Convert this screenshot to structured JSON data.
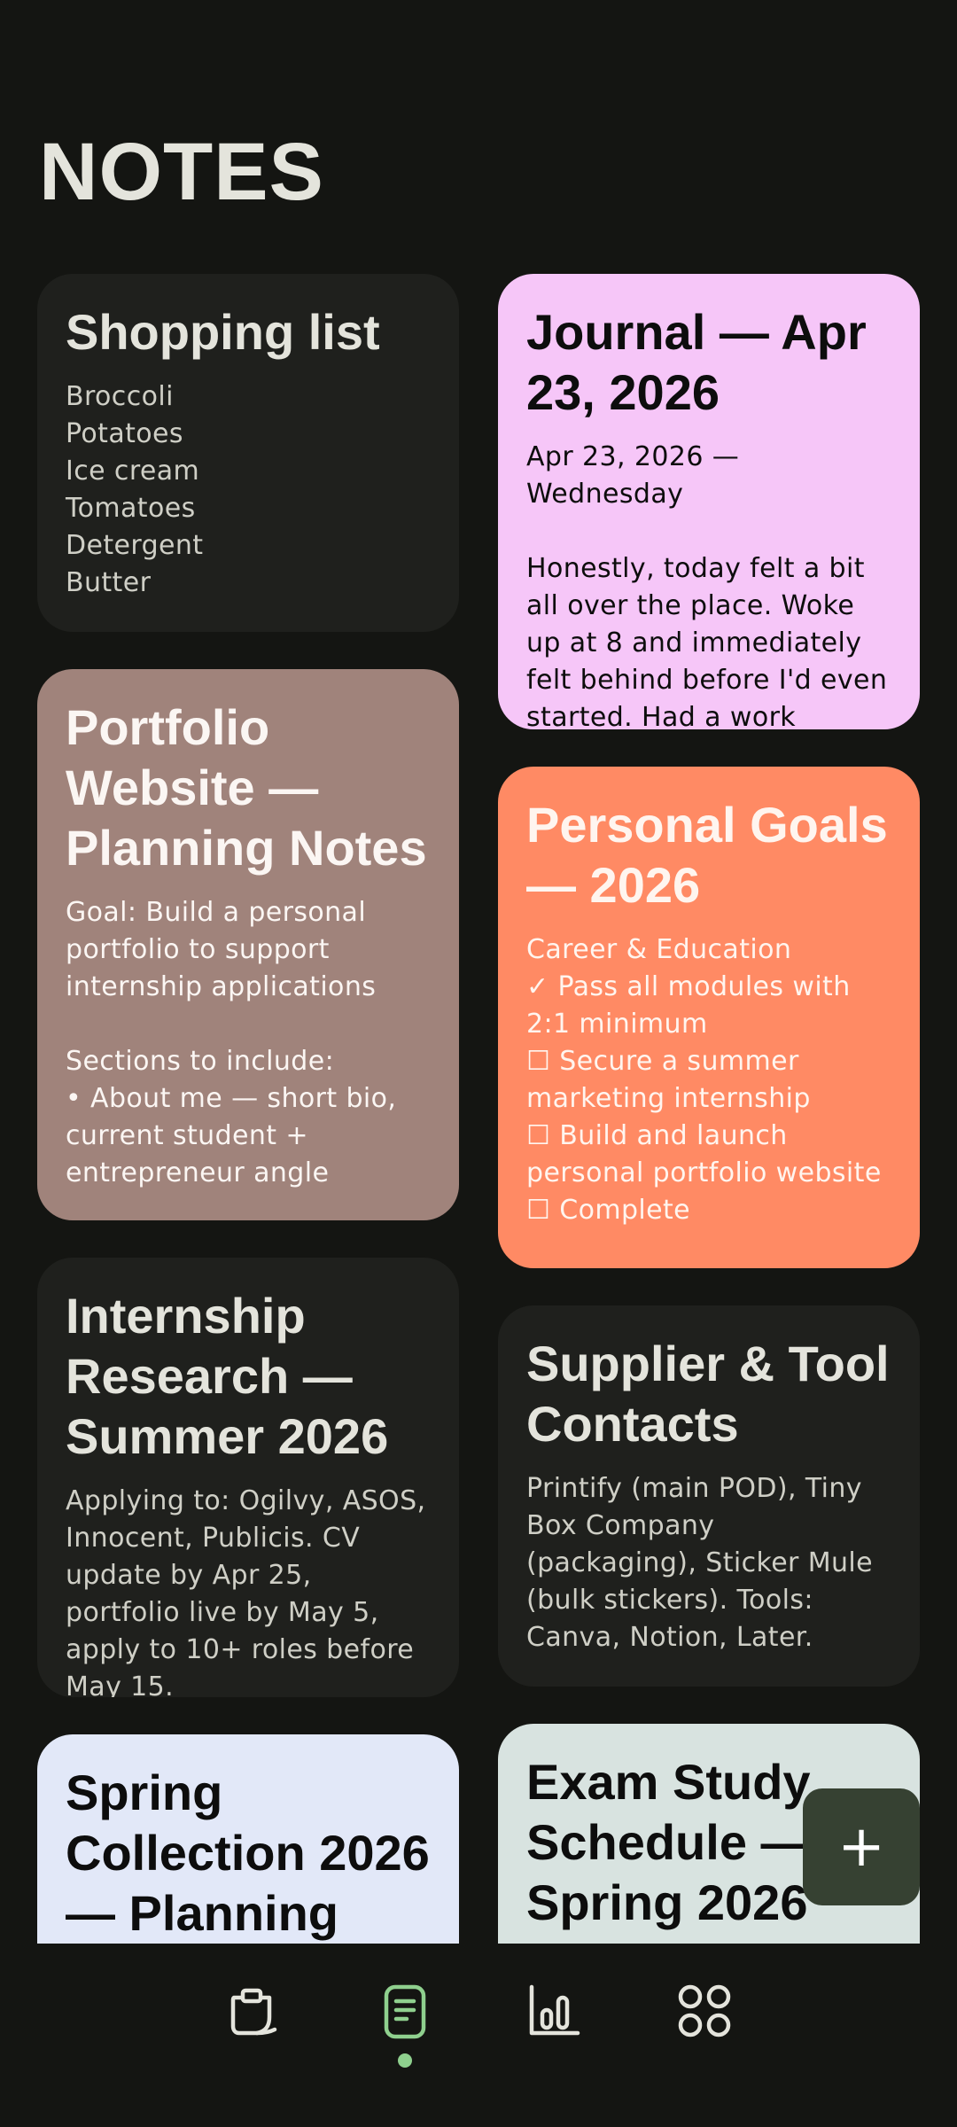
{
  "header": {
    "title": "NOTES"
  },
  "notes_left": [
    {
      "title": "Shopping list",
      "body": "Broccoli\nPotatoes\nIce cream\nTomatoes\nDetergent\nButter",
      "color": "#1f201d"
    },
    {
      "title": "Portfolio Website — Planning Notes",
      "body": "Goal: Build a personal portfolio to support internship applications\n\nSections to include:\n• About me — short bio, current student + entrepreneur angle",
      "color": "#a0837b"
    },
    {
      "title": "Internship Research — Summer 2026",
      "body": "Applying to: Ogilvy, ASOS, Innocent, Publicis. CV update by Apr 25, portfolio live by May 5, apply to 10+ roles before May 15.",
      "color": "#1f201d"
    },
    {
      "title": "Spring Collection 2026 — Planning",
      "body": "",
      "color": "#e2e8f8"
    }
  ],
  "notes_right": [
    {
      "title": "Journal — Apr 23, 2026",
      "body": "Apr 23, 2026 — Wednesday\n\nHonestly, today felt a bit all over the place. Woke up at 8 and immediately felt behind before I'd even started. Had a work",
      "color": "#f6c6f8"
    },
    {
      "title": "Personal Goals — 2026",
      "body": "Career & Education\n✓ Pass all modules with 2:1 minimum\n☐ Secure a summer marketing internship\n☐ Build and launch personal portfolio website\n☐ Complete",
      "color": "#ff8a64"
    },
    {
      "title": "Supplier & Tool Contacts",
      "body": "Printify (main POD), Tiny Box Company (packaging), Sticker Mule (bulk stickers). Tools: Canva, Notion, Later.",
      "color": "#1f201d"
    },
    {
      "title": "Exam Study Schedule — Spring 2026",
      "body": "",
      "color": "#d8e3e0"
    }
  ],
  "fab": {
    "label": "+",
    "icon": "plus-icon"
  },
  "bottom_nav": {
    "items": [
      {
        "icon": "clipboard-icon",
        "active": false
      },
      {
        "icon": "notes-icon",
        "active": true,
        "accent": "#8fd08e"
      },
      {
        "icon": "chart-icon",
        "active": false
      },
      {
        "icon": "grid-icon",
        "active": false
      }
    ]
  }
}
